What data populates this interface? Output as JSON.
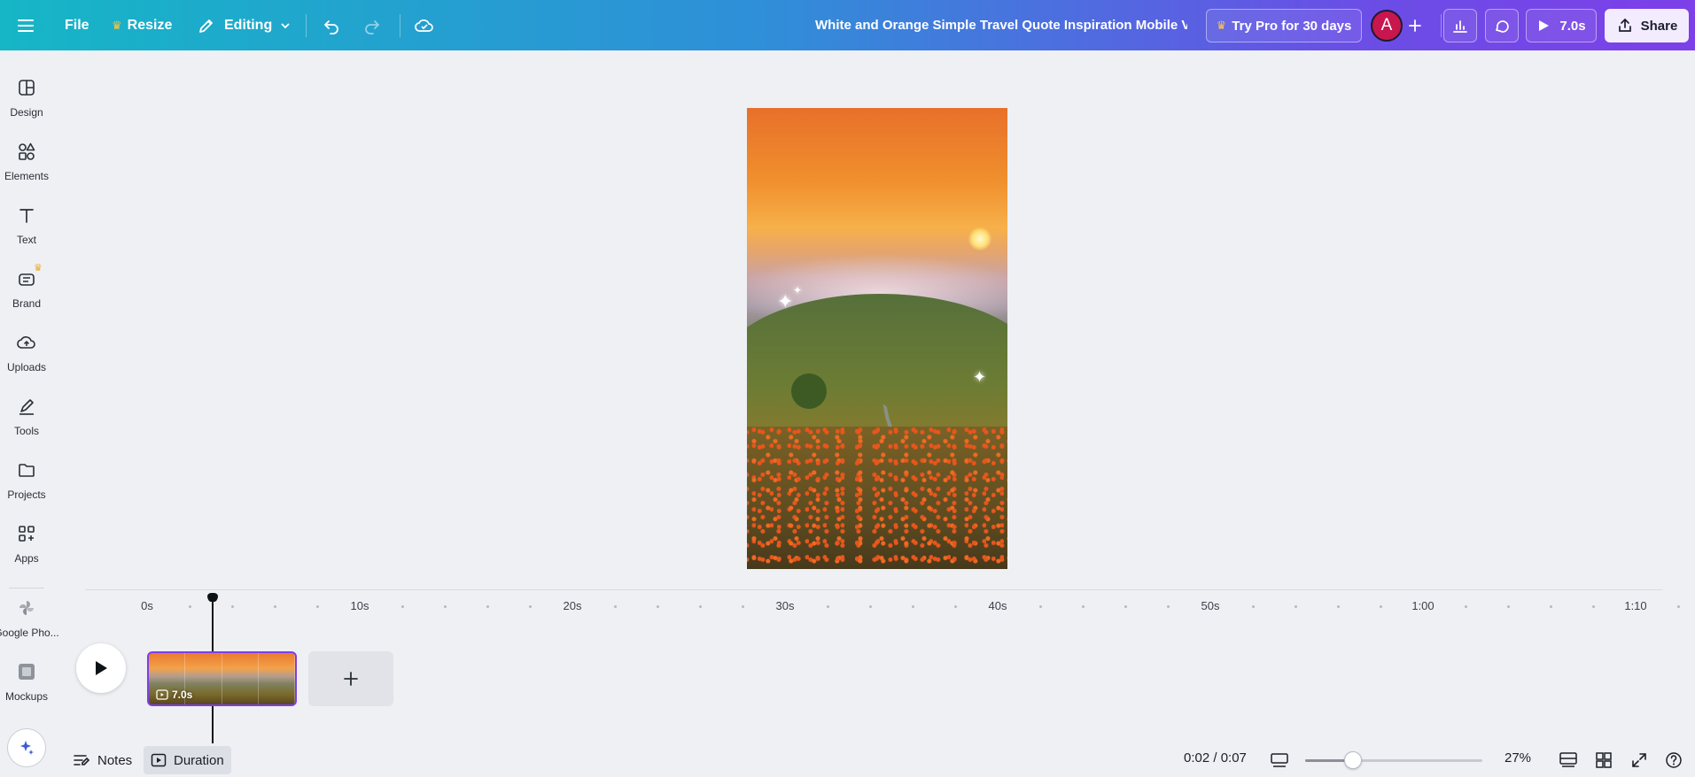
{
  "topbar": {
    "file_label": "File",
    "resize_label": "Resize",
    "editing_label": "Editing",
    "doc_title": "White and Orange Simple Travel Quote Inspiration Mobile V...",
    "try_pro_label": "Try Pro for 30 days",
    "avatar_initial": "A",
    "play_duration_label": "7.0s",
    "share_label": "Share"
  },
  "sidebar": {
    "items": [
      {
        "label": "Design",
        "icon": "design-icon"
      },
      {
        "label": "Elements",
        "icon": "elements-icon"
      },
      {
        "label": "Text",
        "icon": "text-icon"
      },
      {
        "label": "Brand",
        "icon": "brand-icon"
      },
      {
        "label": "Uploads",
        "icon": "uploads-icon"
      },
      {
        "label": "Tools",
        "icon": "tools-icon"
      },
      {
        "label": "Projects",
        "icon": "projects-icon"
      },
      {
        "label": "Apps",
        "icon": "apps-icon"
      },
      {
        "label": "Google Pho...",
        "icon": "google-photos-icon"
      },
      {
        "label": "Mockups",
        "icon": "mockups-icon"
      }
    ]
  },
  "timeline": {
    "ticks": [
      "0s",
      "10s",
      "20s",
      "30s",
      "40s",
      "50s",
      "1:00",
      "1:10"
    ],
    "clip_duration": "7.0s",
    "playhead_seconds": 3.1
  },
  "bottombar": {
    "notes_label": "Notes",
    "duration_label": "Duration",
    "time_readout": "0:02 / 0:07",
    "zoom_percent": "27%",
    "zoom_level": 0.27
  },
  "colors": {
    "accent": "#7d3fe8",
    "avatar": "#c8164f",
    "crown": "#ffc53d"
  }
}
